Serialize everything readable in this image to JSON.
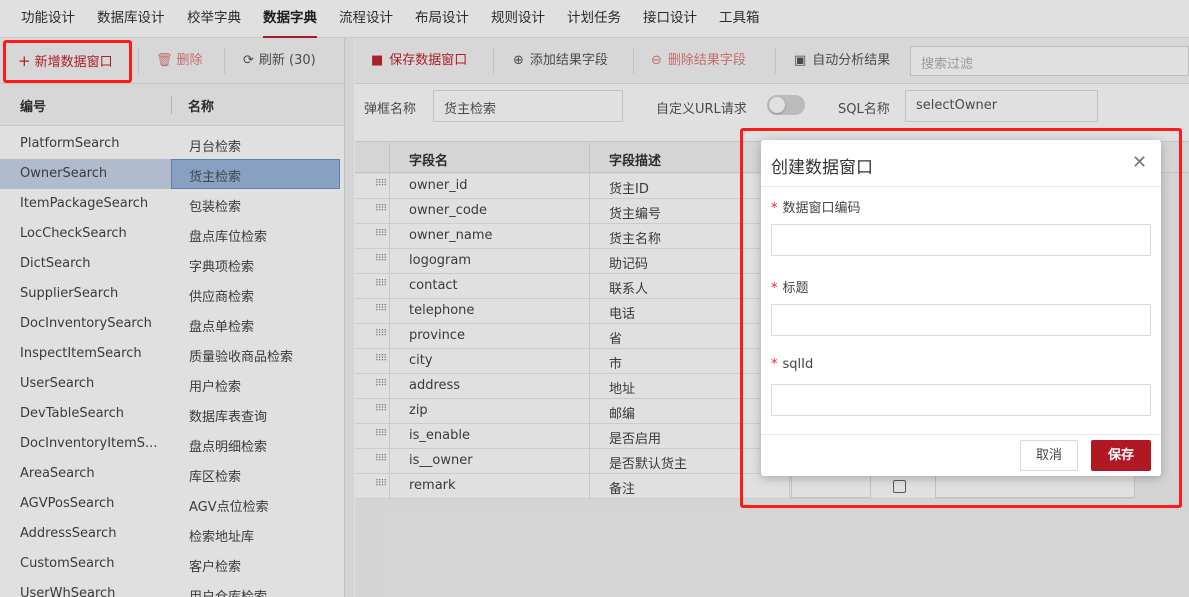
{
  "top_menu": [
    "功能设计",
    "数据库设计",
    "校举字典",
    "数据字典",
    "流程设计",
    "布局设计",
    "规则设计",
    "计划任务",
    "接口设计",
    "工具箱"
  ],
  "left_toolbar": {
    "add_label": "新增数据窗口",
    "delete_label": "删除",
    "refresh_label": "刷新 (30)"
  },
  "left_table": {
    "headers": {
      "code": "编号",
      "name": "名称"
    },
    "rows": [
      {
        "code": "PlatformSearch",
        "name": "月台检索"
      },
      {
        "code": "OwnerSearch",
        "name": "货主检索"
      },
      {
        "code": "ItemPackageSearch",
        "name": "包装检索"
      },
      {
        "code": "LocCheckSearch",
        "name": "盘点库位检索"
      },
      {
        "code": "DictSearch",
        "name": "字典项检索"
      },
      {
        "code": "SupplierSearch",
        "name": "供应商检索"
      },
      {
        "code": "DocInventorySearch",
        "name": "盘点单检索"
      },
      {
        "code": "InspectItemSearch",
        "name": "质量验收商品检索"
      },
      {
        "code": "UserSearch",
        "name": "用户检索"
      },
      {
        "code": "DevTableSearch",
        "name": "数据库表查询"
      },
      {
        "code": "DocInventoryItemS...",
        "name": "盘点明细检索"
      },
      {
        "code": "AreaSearch",
        "name": "库区检索"
      },
      {
        "code": "AGVPosSearch",
        "name": "AGV点位检索"
      },
      {
        "code": "AddressSearch",
        "name": "检索地址库"
      },
      {
        "code": "CustomSearch",
        "name": "客户检索"
      },
      {
        "code": "UserWhSearch",
        "name": "用户仓库检索"
      }
    ]
  },
  "right_toolbar": {
    "save_label": "保存数据窗口",
    "add_field_label": "添加结果字段",
    "delete_field_label": "删除结果字段",
    "auto_analyze_label": "自动分析结果",
    "search_placeholder": "搜索过滤"
  },
  "form": {
    "popup_name_label": "弹框名称",
    "popup_name_value": "货主检索",
    "custom_url_label": "自定义URL请求",
    "sql_name_label": "SQL名称",
    "sql_name_value": "selectOwner"
  },
  "grid": {
    "headers": {
      "field_name": "字段名",
      "field_desc": "字段描述"
    },
    "rows": [
      {
        "name": "owner_id",
        "desc": "货主ID"
      },
      {
        "name": "owner_code",
        "desc": "货主编号"
      },
      {
        "name": "owner_name",
        "desc": "货主名称"
      },
      {
        "name": "logogram",
        "desc": "助记码"
      },
      {
        "name": "contact",
        "desc": "联系人"
      },
      {
        "name": "telephone",
        "desc": "电话"
      },
      {
        "name": "province",
        "desc": "省"
      },
      {
        "name": "city",
        "desc": "市"
      },
      {
        "name": "address",
        "desc": "地址"
      },
      {
        "name": "zip",
        "desc": "邮编"
      },
      {
        "name": "is_enable",
        "desc": "是否启用"
      },
      {
        "name": "is__owner",
        "desc": "是否默认货主"
      },
      {
        "name": "remark",
        "desc": "备注"
      }
    ]
  },
  "dialog": {
    "title": "创建数据窗口",
    "field_code_label": "数据窗口编码",
    "field_title_label": "标题",
    "field_sqlid_label": "sqlId",
    "required_mark": "*",
    "cancel_label": "取消",
    "save_label": "保存"
  },
  "colors": {
    "accent": "#b01824",
    "highlight": "#ff1a1a",
    "selected_row": "#9bb8dd"
  }
}
